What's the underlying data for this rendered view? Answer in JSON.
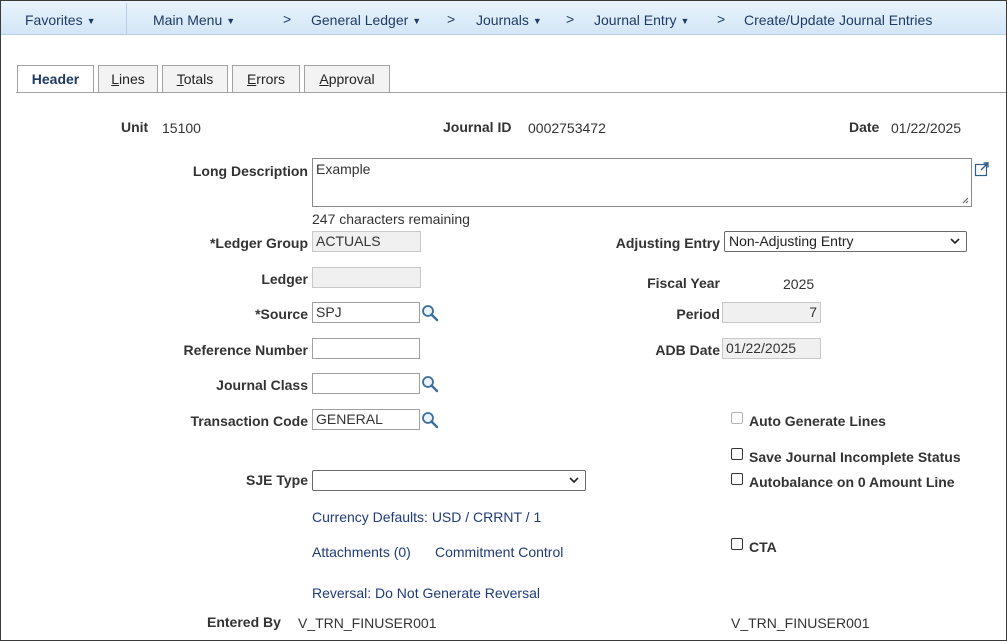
{
  "breadcrumbs": {
    "favorites": "Favorites",
    "main_menu": "Main Menu",
    "general_ledger": "General Ledger",
    "journals": "Journals",
    "journal_entry": "Journal Entry",
    "current": "Create/Update Journal Entries",
    "separator": ">"
  },
  "tabs": [
    {
      "label_u": "",
      "label_rest": "Header",
      "active": true
    },
    {
      "label_u": "L",
      "label_rest": "ines"
    },
    {
      "label_u": "T",
      "label_rest": "otals"
    },
    {
      "label_u": "E",
      "label_rest": "rrors"
    },
    {
      "label_u": "A",
      "label_rest": "pproval"
    }
  ],
  "header": {
    "unit_label": "Unit",
    "unit_value": "15100",
    "journal_id_label": "Journal ID",
    "journal_id_value": "0002753472",
    "date_label": "Date",
    "date_value": "01/22/2025"
  },
  "form": {
    "long_description_label": "Long Description",
    "long_description_value": "Example",
    "chars_remaining": "247 characters remaining",
    "ledger_group_label": "*Ledger Group",
    "ledger_group_value": "ACTUALS",
    "ledger_label": "Ledger",
    "ledger_value": "",
    "source_label": "*Source",
    "source_value": "SPJ",
    "reference_number_label": "Reference Number",
    "reference_number_value": "",
    "journal_class_label": "Journal Class",
    "journal_class_value": "",
    "transaction_code_label": "Transaction Code",
    "transaction_code_value": "GENERAL",
    "sje_type_label": "SJE Type",
    "sje_type_value": "",
    "adjusting_entry_label": "Adjusting Entry",
    "adjusting_entry_value": "Non-Adjusting Entry",
    "fiscal_year_label": "Fiscal Year",
    "fiscal_year_value": "2025",
    "period_label": "Period",
    "period_value": "7",
    "adb_date_label": "ADB Date",
    "adb_date_value": "01/22/2025"
  },
  "options": {
    "auto_generate_lines": {
      "label": "Auto Generate Lines",
      "checked": false,
      "disabled": true
    },
    "save_incomplete": {
      "label": "Save Journal Incomplete Status",
      "checked": false
    },
    "autobalance": {
      "label": "Autobalance on 0 Amount Line",
      "checked": false
    },
    "cta": {
      "label": "CTA",
      "checked": false
    }
  },
  "links": {
    "currency_defaults": "Currency Defaults: USD / CRRNT / 1",
    "attachments": "Attachments (0)",
    "commitment_control": "Commitment Control",
    "reversal": "Reversal: Do Not Generate Reversal"
  },
  "footer": {
    "entered_by_label": "Entered By",
    "entered_by_value": "V_TRN_FINUSER001",
    "entered_by_name": "V_TRN_FINUSER001"
  },
  "colors": {
    "nav_text": "#1f3b63",
    "link": "#1f3b7a",
    "nav_bg": "#d3e6f7"
  },
  "icons": [
    "chevron-down-icon",
    "lookup-icon",
    "expand-icon",
    "resize-grip-icon"
  ]
}
